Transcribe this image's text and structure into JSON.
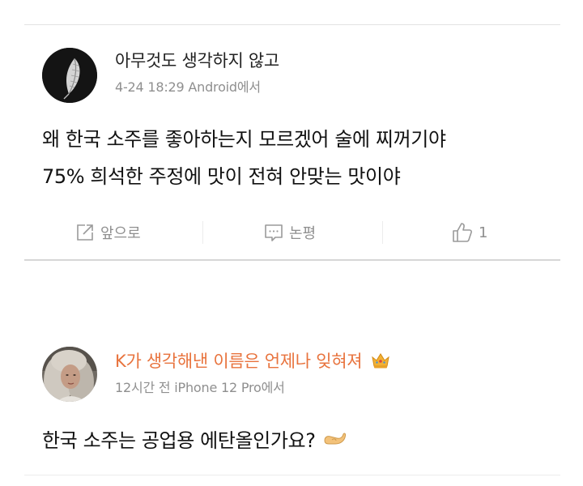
{
  "colors": {
    "accent_username": "#e8733d",
    "gray_text": "#8f8f8f",
    "body_text": "#111111"
  },
  "comments": [
    {
      "username": "아무것도 생각하지 않고",
      "username_color": "#222222",
      "meta": "4-24 18:29 Android에서",
      "text_lines": [
        "왜 한국 소주를 좋아하는지 모르겠어 술에 찌꺼기야",
        "75% 희석한 주정에 맛이 전혀 안맞는 맛이야"
      ],
      "actions": {
        "forward_label": "앞으로",
        "comment_label": "논평",
        "like_count": "1"
      }
    },
    {
      "username": "K가 생각해낸 이름은 언제나 잊혀져",
      "username_color": "#e8733d",
      "badge": "crown-icon",
      "meta": "12시간 전 iPhone 12 Pro에서",
      "text_lines": [
        "한국 소주는 공업용 에탄올인가요?"
      ],
      "text_emoji": "flexed-arm-emoji"
    }
  ]
}
